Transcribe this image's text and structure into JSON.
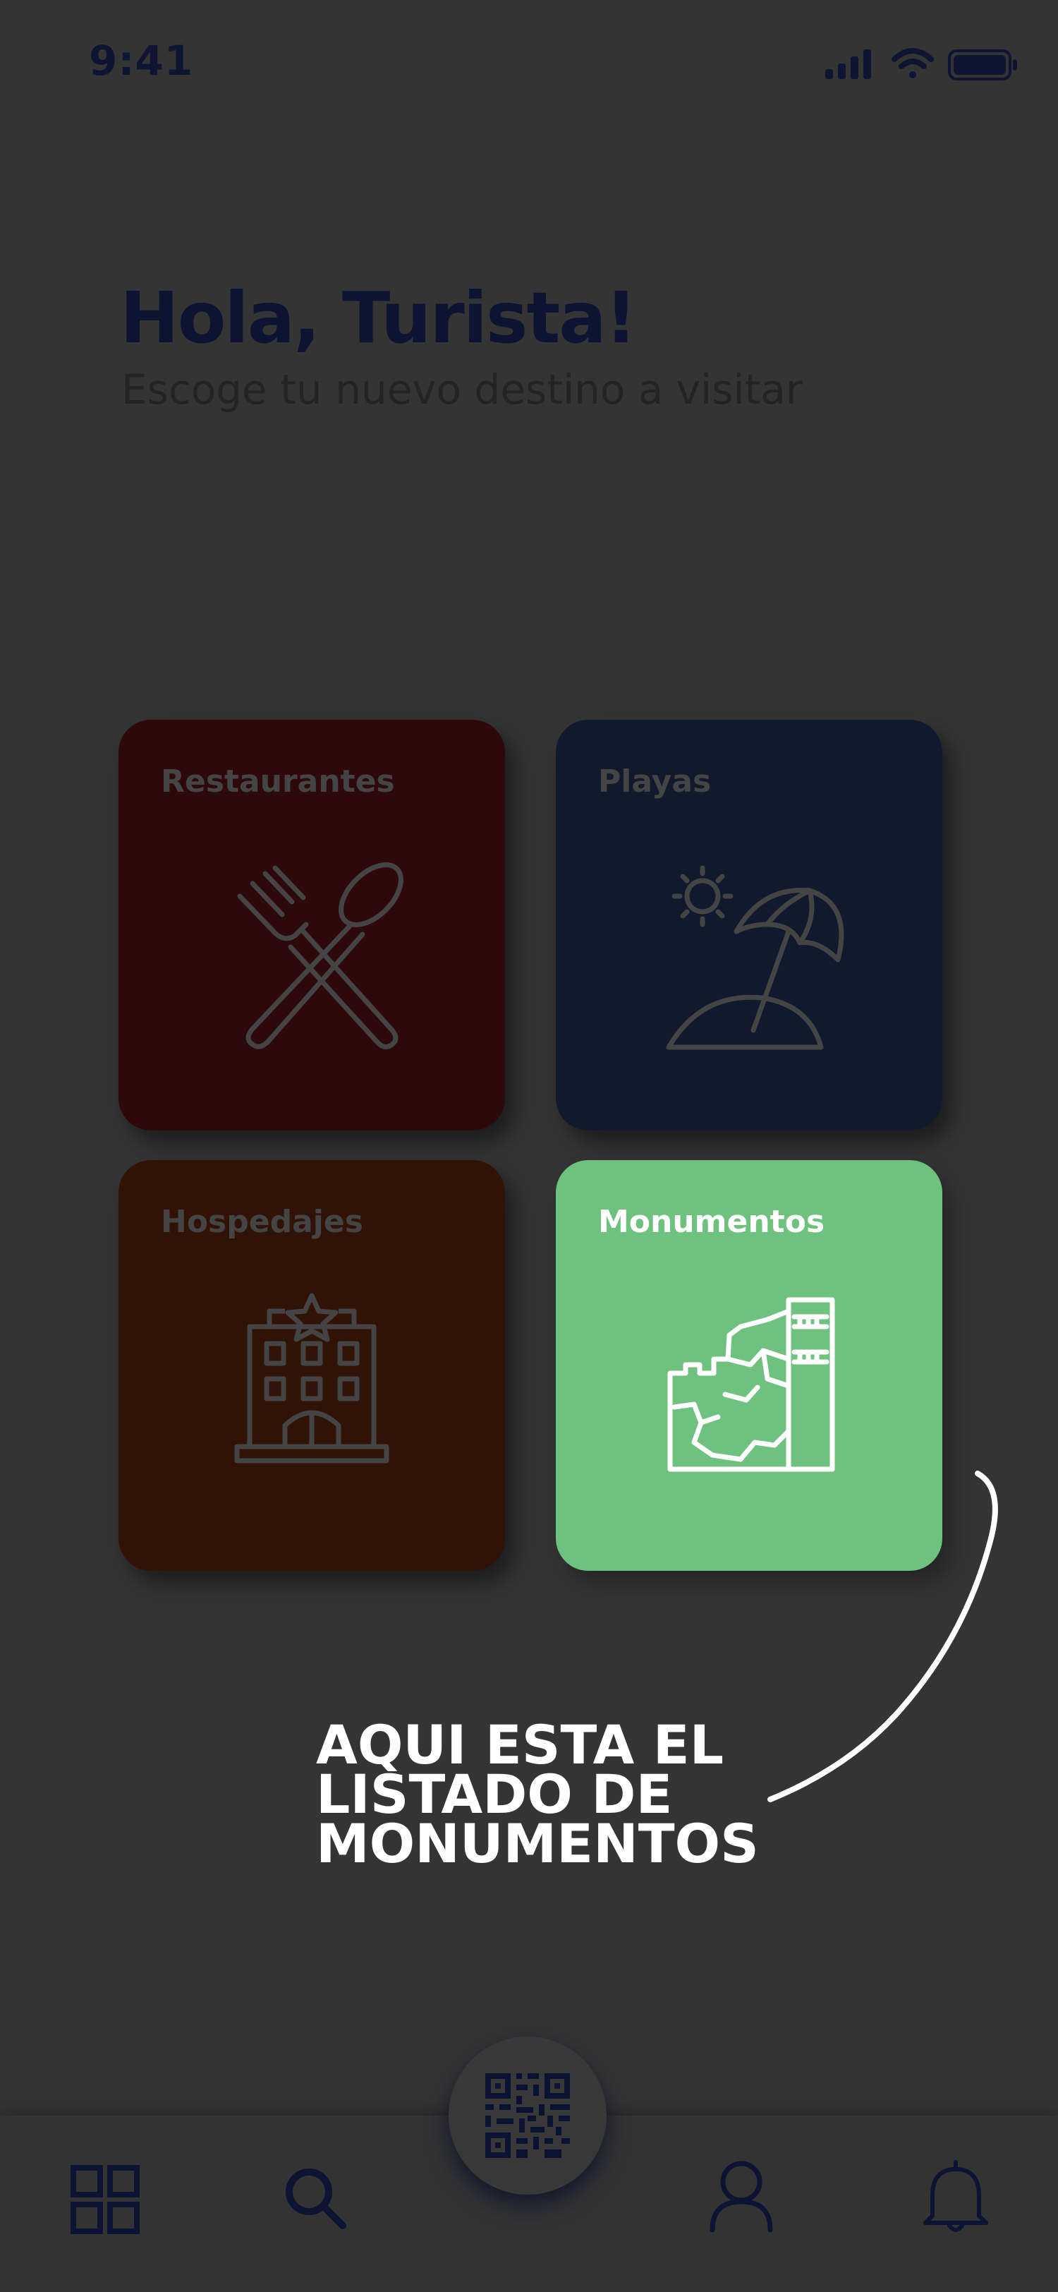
{
  "status_bar": {
    "time": "9:41"
  },
  "header": {
    "greeting": "Hola, Turista!",
    "subtitle": "Escoge tu nuevo destino a visitar"
  },
  "categories": [
    {
      "label": "Restaurantes",
      "icon": "fork-spoon-icon",
      "color": "#2e090c"
    },
    {
      "label": "Playas",
      "icon": "beach-umbrella-icon",
      "color": "#101a2c"
    },
    {
      "label": "Hospedajes",
      "icon": "hotel-icon",
      "color": "#301306"
    },
    {
      "label": "Monumentos",
      "icon": "ruins-icon",
      "color": "#6fc17f"
    }
  ],
  "annotation": {
    "line1": "AQUI ESTA EL",
    "line2": "LISTADO DE",
    "line3": "MONUMENTOS"
  },
  "tab_bar": {
    "items": [
      "grid-icon",
      "search-icon",
      "qr-code-icon",
      "user-icon",
      "bell-icon"
    ]
  }
}
